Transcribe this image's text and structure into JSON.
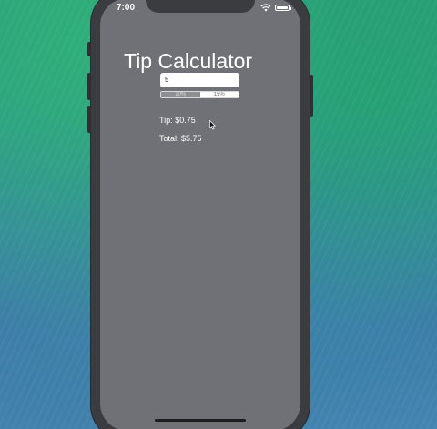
{
  "status_bar": {
    "time": "7:00",
    "icons": [
      "wifi-icon",
      "battery-icon"
    ]
  },
  "app": {
    "title": "Tip Calculator",
    "bill_amount_value": "5",
    "tip_options": [
      {
        "label": "10%",
        "selected": true
      },
      {
        "label": "15%",
        "selected": false
      }
    ],
    "tip_label": "Tip:",
    "tip_value": "$0.75",
    "total_label": "Total:",
    "total_value": "$5.75"
  },
  "colors": {
    "screen_background": "#6f7177",
    "text": "#ffffff",
    "field_background": "#ffffff"
  }
}
